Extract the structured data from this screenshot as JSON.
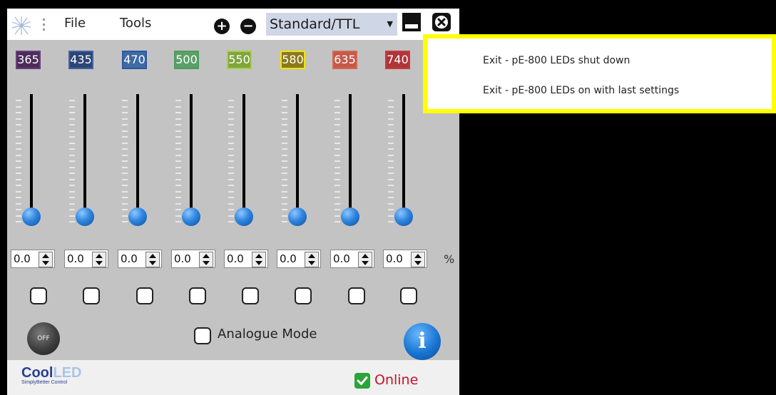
{
  "titlebar": {
    "menus": [
      "File",
      "Tools"
    ],
    "mode": "Standard/TTL"
  },
  "wavelengths": [
    {
      "label": "365",
      "fill": "#4b2c59",
      "border": "#6a3f7d"
    },
    {
      "label": "435",
      "fill": "#2d4575",
      "border": "#43639f"
    },
    {
      "label": "470",
      "fill": "#3f6aa2",
      "border": "#2d58a0"
    },
    {
      "label": "500",
      "fill": "#5aa068",
      "border": "#4f9a62"
    },
    {
      "label": "550",
      "fill": "#7fa53d",
      "border": "#a8d046"
    },
    {
      "label": "580",
      "fill": "#8c7a1a",
      "border": "#f2e300"
    },
    {
      "label": "635",
      "fill": "#c6584a",
      "border": "#d7664f"
    },
    {
      "label": "740",
      "fill": "#b0343a",
      "border": "#c23b3b"
    }
  ],
  "intensities": [
    "0.0",
    "0.0",
    "0.0",
    "0.0",
    "0.0",
    "0.0",
    "0.0",
    "0.0"
  ],
  "unit_label": "%",
  "off_button_label": "OFF",
  "analogue_label": "Analogue Mode",
  "info_label": "i",
  "brand": {
    "name_a": "Cool",
    "name_b": "LED",
    "tagline": "SimplyBetter Control"
  },
  "status_label": "Online",
  "exit_menu": {
    "items": [
      "Exit - pE-800 LEDs shut down",
      "Exit - pE-800 LEDs on with last settings"
    ]
  }
}
